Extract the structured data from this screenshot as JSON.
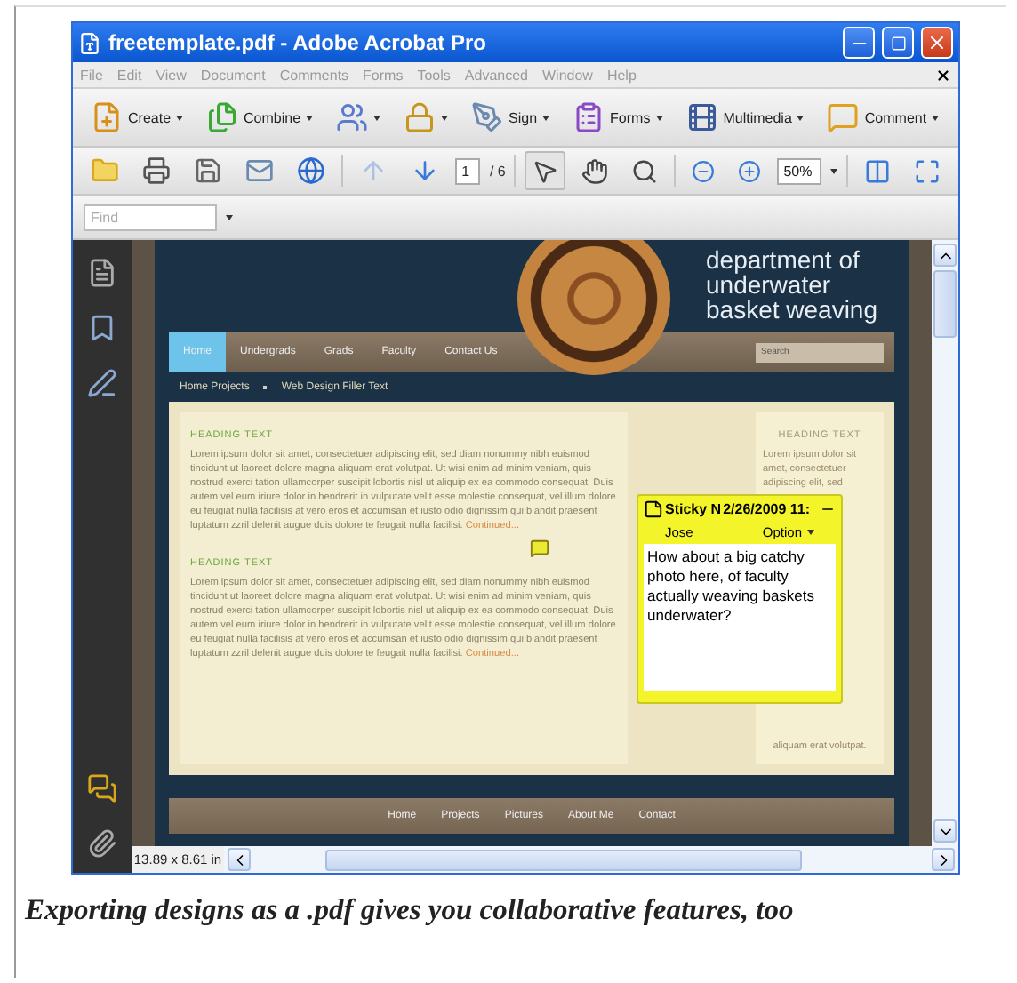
{
  "window": {
    "title": "freetemplate.pdf - Adobe Acrobat Pro"
  },
  "menu": [
    "File",
    "Edit",
    "View",
    "Document",
    "Comments",
    "Forms",
    "Tools",
    "Advanced",
    "Window",
    "Help"
  ],
  "toolbar": [
    {
      "kind": "create",
      "label": "Create"
    },
    {
      "kind": "combine",
      "label": "Combine"
    },
    {
      "kind": "share"
    },
    {
      "kind": "secure"
    },
    {
      "kind": "sign",
      "label": "Sign"
    },
    {
      "kind": "forms",
      "label": "Forms"
    },
    {
      "kind": "multimedia",
      "label": "Multimedia"
    },
    {
      "kind": "comment",
      "label": "Comment"
    }
  ],
  "navigation": {
    "previous_disabled": true,
    "page": "1",
    "page_count": "/ 6",
    "zoom": "50%"
  },
  "view_tools": [
    {
      "kind": "select",
      "selected": true
    },
    {
      "kind": "hand",
      "selected": false
    },
    {
      "kind": "marquee",
      "selected": false
    }
  ],
  "find": {
    "placeholder": "Find"
  },
  "document": {
    "site_title": "department of underwater basket weaving",
    "nav": [
      {
        "label": "Home",
        "selected": true
      },
      {
        "label": "Undergrads",
        "selected": false
      },
      {
        "label": "Grads",
        "selected": false
      },
      {
        "label": "Faculty",
        "selected": false
      },
      {
        "label": "Contact Us",
        "selected": false
      }
    ],
    "search": {
      "placeholder": "Search"
    },
    "breadcrumb": [
      "Home Projects",
      "Web Design Filler Text"
    ],
    "sections": [
      {
        "heading": "HEADING TEXT",
        "body": "Lorem ipsum dolor sit amet, consectetuer adipiscing elit, sed diam nonummy nibh euismod tincidunt ut laoreet dolore magna aliquam erat volutpat. Ut wisi enim ad minim veniam, quis nostrud exerci tation ullamcorper suscipit lobortis nisl ut aliquip ex ea commodo consequat. Duis autem vel eum iriure dolor in hendrerit in vulputate velit esse molestie consequat, vel illum dolore eu feugiat nulla facilisis at vero eros et accumsan et iusto odio dignissim qui blandit praesent luptatum zzril delenit augue duis dolore te feugait nulla facilisi.",
        "link": "Continued..."
      },
      {
        "heading": "HEADING TEXT",
        "body": "Lorem ipsum dolor sit amet, consectetuer adipiscing elit, sed diam nonummy nibh euismod tincidunt ut laoreet dolore magna aliquam erat volutpat. Ut wisi enim ad minim veniam, quis nostrud exerci tation ullamcorper suscipit lobortis nisl ut aliquip ex ea commodo consequat. Duis autem vel eum iriure dolor in hendrerit in vulputate velit esse molestie consequat, vel illum dolore eu feugiat nulla facilisis at vero eros et accumsan et iusto odio dignissim qui blandit praesent luptatum zzril delenit augue duis dolore te feugait nulla facilisi.",
        "link": "Continued..."
      }
    ],
    "sidebar": {
      "heading": "HEADING TEXT",
      "texts": [
        "Lorem ipsum dolor sit amet, consectetuer adipiscing elit, sed",
        "aliquam erat volutpat."
      ]
    },
    "footer_links": [
      "Home",
      "Projects",
      "Pictures",
      "About Me",
      "Contact"
    ]
  },
  "sticky_note": {
    "title": "Sticky N",
    "date": "2/26/2009 11:",
    "author": "Jose",
    "options": "Option",
    "text": "How about a big catchy photo here, of faculty actually weaving baskets underwater?"
  },
  "status": {
    "page_size": "13.89 x 8.61 in"
  },
  "caption": "Exporting designs as a .pdf gives you collaborative features, too"
}
